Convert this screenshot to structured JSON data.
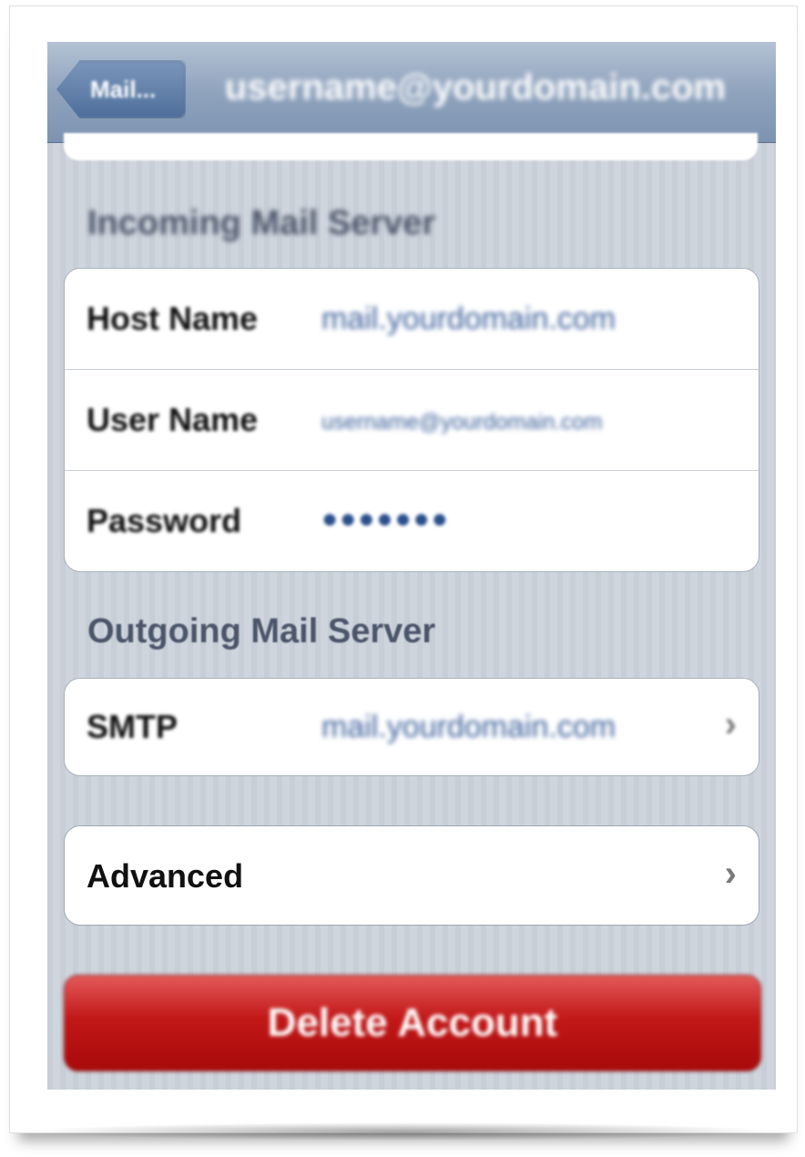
{
  "nav": {
    "back_label": "Mail...",
    "title": "username@yourdomain.com"
  },
  "incoming": {
    "section_title": "Incoming Mail Server",
    "rows": [
      {
        "label": "Host Name",
        "value": "mail.yourdomain.com"
      },
      {
        "label": "User Name",
        "value": "username@yourdomain.com"
      },
      {
        "label": "Password",
        "value": "●●●●●●●"
      }
    ]
  },
  "outgoing": {
    "section_title": "Outgoing Mail Server",
    "smtp_label": "SMTP",
    "smtp_value": "mail.yourdomain.com"
  },
  "advanced": {
    "label": "Advanced"
  },
  "delete": {
    "label": "Delete Account"
  },
  "icons": {
    "chevron": "chevron-right-icon",
    "back": "back-arrow-button"
  },
  "colors": {
    "navbar": "#8fa3bd",
    "value_text": "#3b5f9a",
    "delete_button": "#c21818",
    "background_stripes": "#c8ced7"
  }
}
